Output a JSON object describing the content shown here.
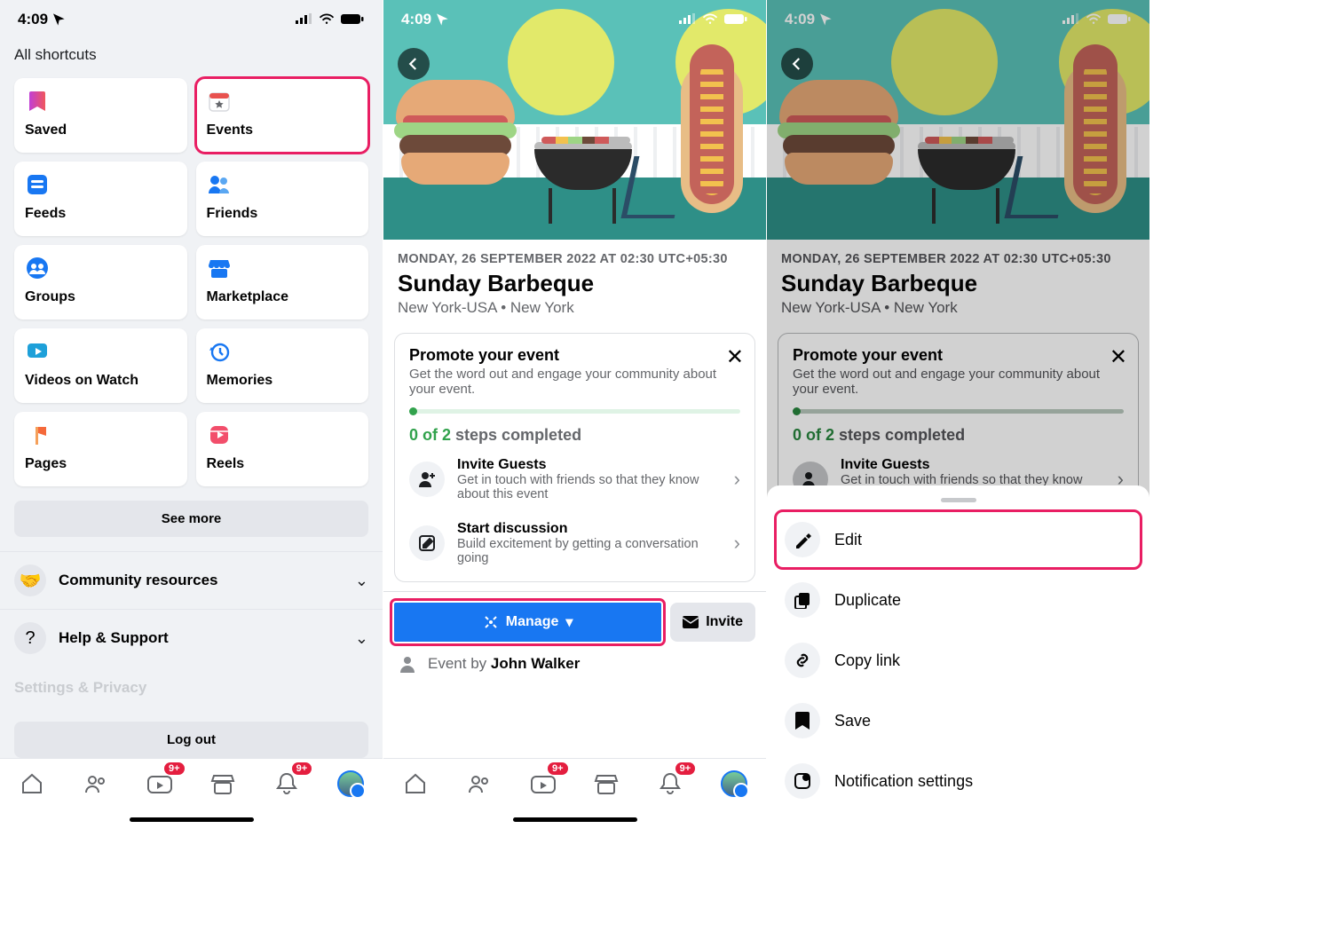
{
  "status": {
    "time": "4:09"
  },
  "screen1": {
    "header": "All shortcuts",
    "cards": [
      {
        "label": "Saved"
      },
      {
        "label": "Events"
      },
      {
        "label": "Feeds"
      },
      {
        "label": "Friends"
      },
      {
        "label": "Groups"
      },
      {
        "label": "Marketplace"
      },
      {
        "label": "Videos on Watch"
      },
      {
        "label": "Memories"
      },
      {
        "label": "Pages"
      },
      {
        "label": "Reels"
      }
    ],
    "see_more": "See more",
    "rows": [
      {
        "label": "Community resources"
      },
      {
        "label": "Help & Support"
      }
    ],
    "ghost": "Settings & Privacy",
    "logout": "Log out",
    "badge": "9+"
  },
  "event": {
    "date": "MONDAY, 26 SEPTEMBER 2022 AT 02:30 UTC+05:30",
    "title": "Sunday Barbeque",
    "location": "New York-USA • New York",
    "promote": {
      "title": "Promote your event",
      "desc": "Get the word out and engage your community about your event.",
      "steps_count": "0 of 2",
      "steps_tail": "steps completed",
      "items": [
        {
          "title": "Invite Guests",
          "desc": "Get in touch with friends so that they know about this event"
        },
        {
          "title": "Start discussion",
          "desc": "Build excitement by getting a conversation going"
        }
      ]
    },
    "manage": "Manage",
    "invite": "Invite",
    "host_prefix": "Event by ",
    "host": "John Walker"
  },
  "sheet": {
    "items": [
      {
        "label": "Edit"
      },
      {
        "label": "Duplicate"
      },
      {
        "label": "Copy link"
      },
      {
        "label": "Save"
      },
      {
        "label": "Notification settings"
      }
    ]
  }
}
